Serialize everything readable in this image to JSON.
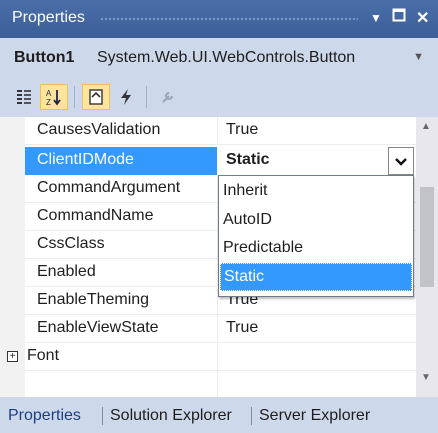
{
  "window": {
    "title": "Properties"
  },
  "object_selector": {
    "name": "Button1",
    "type": "System.Web.UI.WebControls.Button"
  },
  "toolbar": {
    "buttons": [
      "categorized-icon",
      "alphabetical-icon",
      "properties-icon",
      "events-icon",
      "property-pages-icon"
    ],
    "active": "alphabetical-icon"
  },
  "grid": {
    "rows": [
      {
        "name": "CausesValidation",
        "value": "True"
      },
      {
        "name": "ClientIDMode",
        "value": "Static"
      },
      {
        "name": "CommandArgument",
        "value": ""
      },
      {
        "name": "CommandName",
        "value": ""
      },
      {
        "name": "CssClass",
        "value": ""
      },
      {
        "name": "Enabled",
        "value": ""
      },
      {
        "name": "EnableTheming",
        "value": "True"
      },
      {
        "name": "EnableViewState",
        "value": "True"
      },
      {
        "name": "Font",
        "value": ""
      }
    ],
    "selected_row": "ClientIDMode"
  },
  "dropdown": {
    "options": [
      "Inherit",
      "AutoID",
      "Predictable",
      "Static"
    ],
    "selected": "Static"
  },
  "tabs": [
    "Properties",
    "Solution Explorer",
    "Server Explorer"
  ],
  "active_tab": "Properties",
  "colors": {
    "accent": "#3399ff",
    "titlebar": "#3c5f99",
    "chrome": "#cdd8ea"
  }
}
